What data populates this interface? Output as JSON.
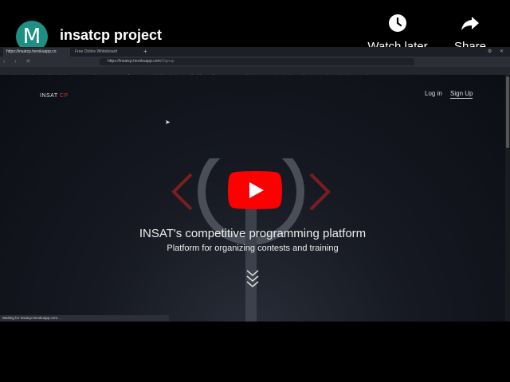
{
  "video": {
    "channel_initial": "M",
    "title": "insatcp project",
    "watch_later_label": "Watch later",
    "share_label": "Share"
  },
  "browser": {
    "tabs": [
      {
        "label": "https://insatcp.herokuapp.co"
      },
      {
        "label": "Free Online Whiteboard"
      }
    ],
    "new_tab": "+",
    "url_host": "https://insatcp.herokuapp.com",
    "url_path": "/Signup",
    "bookmarks": [
      {
        "label": "Getting Started",
        "color": "#e8753a"
      },
      {
        "label": "Wiggly Squiggly",
        "color": "#4a90d9"
      },
      {
        "label": "STAGE Explorer (...",
        "color": "#2e9e5b"
      },
      {
        "label": "stage pfe enterpr...",
        "color": "#2e9e5b"
      },
      {
        "label": "theiebetation/ a...",
        "color": "#cccccc"
      },
      {
        "label": "jlevy/the-art-of-c...",
        "color": "#cccccc"
      },
      {
        "label": "papers-we-love/...",
        "color": "#cccccc"
      },
      {
        "label": "tsatcsr/project-b...",
        "color": "#cccccc"
      },
      {
        "label": "free-programmi...",
        "color": "#cccccc"
      },
      {
        "label": "learning",
        "color": "#888888"
      },
      {
        "label": "reads",
        "color": "#888888"
      },
      {
        "label": "How to Get Starte...",
        "color": "#d9342b"
      }
    ],
    "status_text": "Waiting for insatcp.herokuapp.com..."
  },
  "site": {
    "logo_main": "INSAT",
    "logo_accent": "CP",
    "login": "Log in",
    "signup": "Sign Up",
    "hero_title": "INSAT's competitive programming platform",
    "hero_subtitle": "Platform for organizing contests and training"
  },
  "colors": {
    "accent_red": "#c0392b",
    "play_red": "#ff0000",
    "avatar_teal": "#1f8f83"
  }
}
